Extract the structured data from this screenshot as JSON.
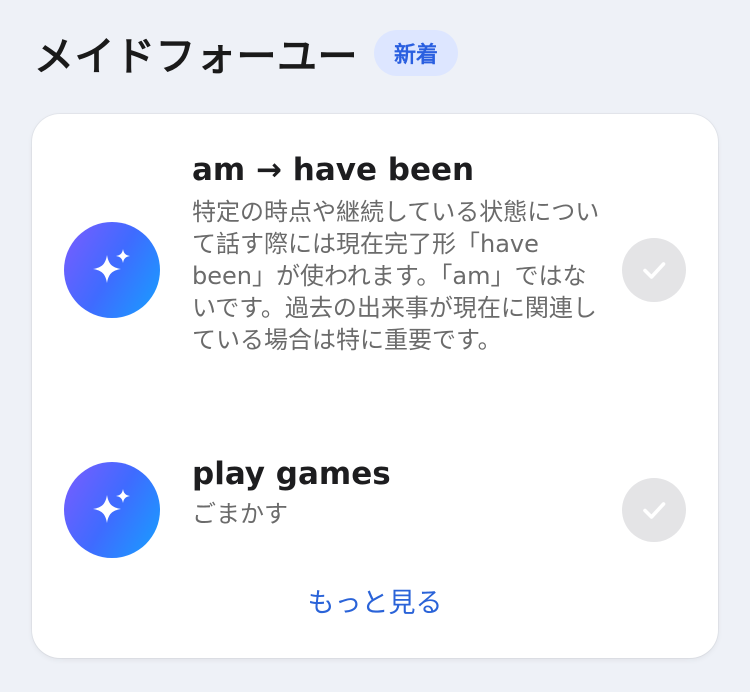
{
  "header": {
    "title": "メイドフォーユー",
    "badge": "新着"
  },
  "items": [
    {
      "icon": "sparkle-icon",
      "title": "am → have been",
      "description": "特定の時点や継続している状態について話す際には現在完了形「have been」が使われます。「am」ではないです。過去の出来事が現在に関連している場合は特に重要です。"
    },
    {
      "icon": "sparkle-icon",
      "title": "play games",
      "description": "ごまかす"
    }
  ],
  "footer": {
    "more_label": "もっと見る"
  },
  "colors": {
    "accent": "#2a63d8",
    "badge_bg": "#dde6ff",
    "check_bg": "#e4e4e6"
  }
}
